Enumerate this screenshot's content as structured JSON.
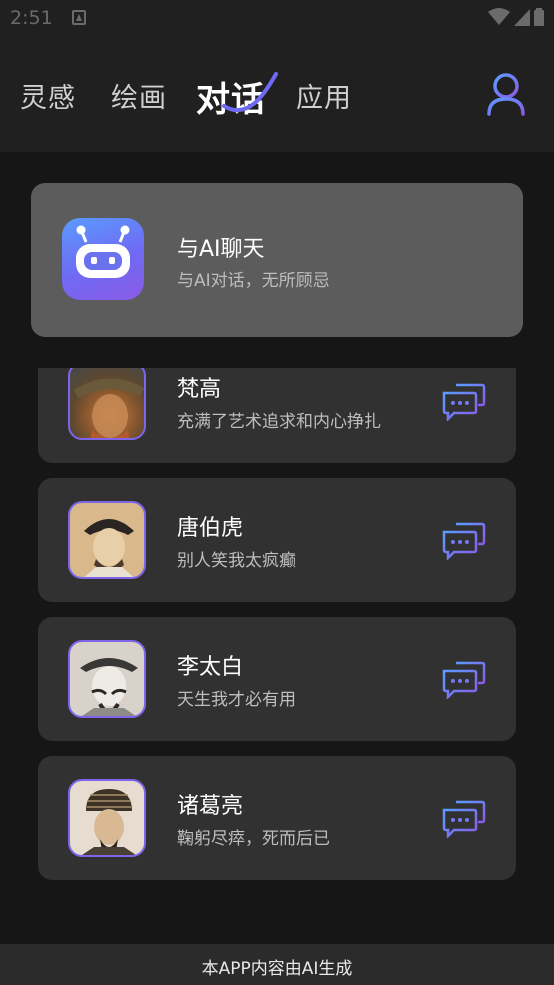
{
  "status_bar": {
    "time": "2:51"
  },
  "header": {
    "tabs": [
      {
        "label": "灵感",
        "active": false
      },
      {
        "label": "绘画",
        "active": false
      },
      {
        "label": "对话",
        "active": true
      },
      {
        "label": "应用",
        "active": false
      }
    ],
    "accent": "#6f6af3"
  },
  "ai_card": {
    "title": "与AI聊天",
    "subtitle": "与AI对话，无所顾忌"
  },
  "characters": [
    {
      "name": "梵高",
      "desc": "充满了艺术追求和内心挣扎"
    },
    {
      "name": "唐伯虎",
      "desc": "别人笑我太疯癫"
    },
    {
      "name": "李太白",
      "desc": "天生我才必有用"
    },
    {
      "name": "诸葛亮",
      "desc": "鞠躬尽瘁，死而后已"
    }
  ],
  "footer": {
    "notice": "本APP内容由AI生成"
  }
}
